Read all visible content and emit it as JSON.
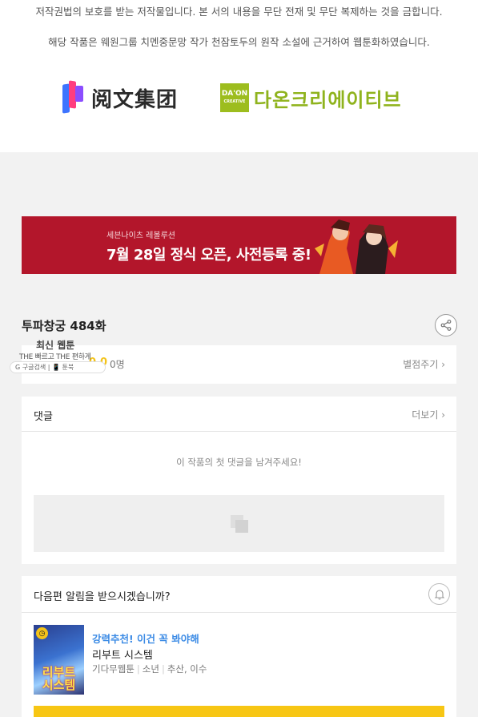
{
  "notice": {
    "line1": "저작권법의 보호를 받는 저작물입니다. 본 서의 내용을 무단 전재 및 무단 복제하는 것을 금합니다.",
    "line2": "해당 작품은 웨원그룹 치멘중문망 작가 천잠토두의 원작 소설에 근거하여 웹툰화하였습니다."
  },
  "logos": {
    "yuewen": "阅文集团",
    "daon_box_top": "DA'ON",
    "daon_box_bottom": "CREATIVE",
    "daon": "다온크리에이티브"
  },
  "banner": {
    "sub": "세븐나이츠 레볼루션",
    "main": "7월 28일 정식 오픈, 사전등록 중!"
  },
  "episode": {
    "title": "투파창궁 484화"
  },
  "rating": {
    "count": "0명",
    "score": "0.0",
    "rate_link": "별점주기 ›"
  },
  "overlay": {
    "title": "최신 웹툰",
    "subtitle": "THE 빠르고 THE 편하게",
    "bar": "G 구글검색 | 📱 툰북"
  },
  "comments": {
    "title": "댓글",
    "more": "더보기 ›",
    "empty": "이 작품의 첫 댓글을 남겨주세요!"
  },
  "notify": {
    "title": "다음편 알림을 받으시겠습니까?"
  },
  "recommend": {
    "tag": "강력추천! 이건 꼭 봐야해",
    "title": "리부트 시스템",
    "thumb_title": "리부트\n시스템",
    "meta": [
      "기다무웹툰",
      "소년",
      "추산, 이수"
    ]
  },
  "colors": {
    "banner": "#b3162b",
    "accent_yellow": "#f7c614",
    "link_blue": "#3c8be5"
  }
}
